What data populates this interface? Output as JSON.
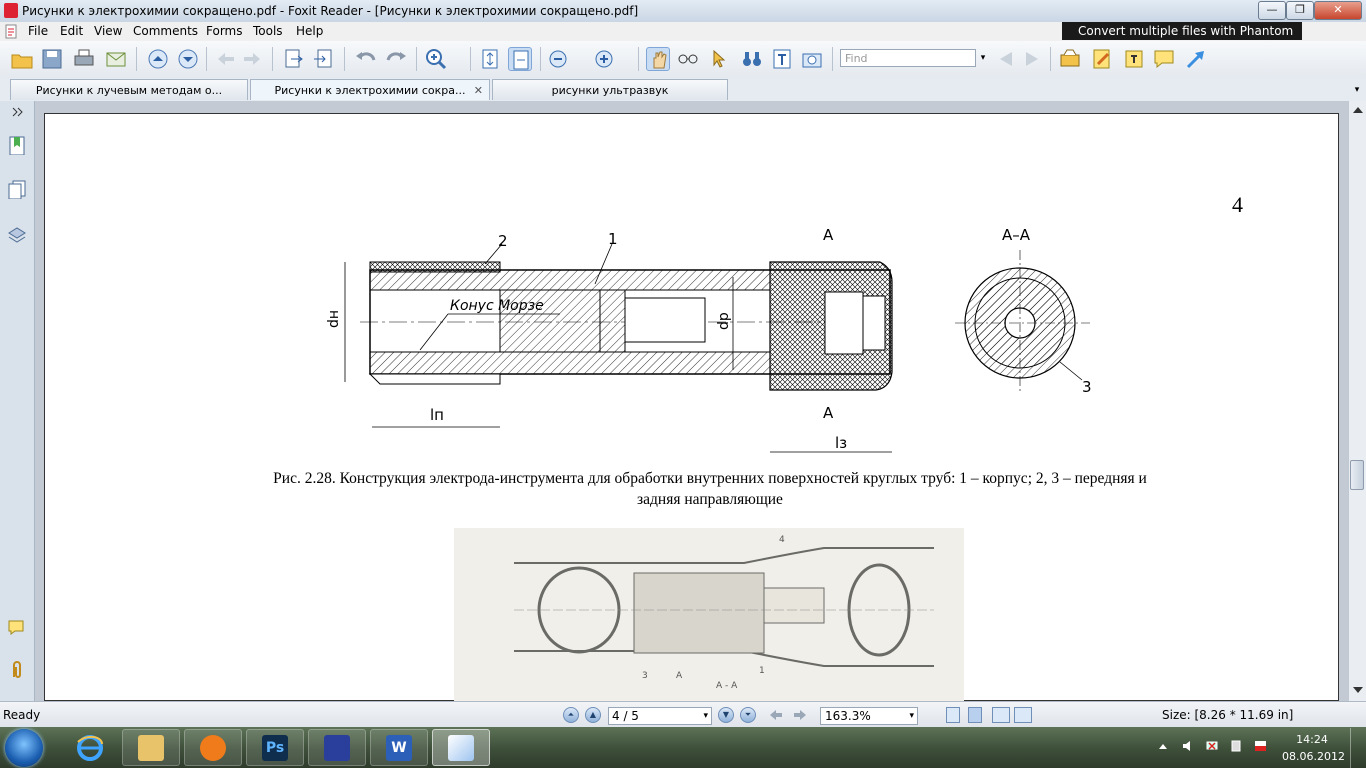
{
  "window": {
    "title": "Рисунки к электрохимии сокращено.pdf - Foxit Reader - [Рисунки к электрохимии сокращено.pdf]",
    "minimize": "—",
    "maximize": "❐",
    "close": "✕"
  },
  "menu": [
    "File",
    "Edit",
    "View",
    "Comments",
    "Forms",
    "Tools",
    "Help"
  ],
  "promo": "Convert multiple files with Phantom",
  "toolbar": {
    "find_placeholder": "Find",
    "find_drop": "▾"
  },
  "tabs": [
    {
      "label": "Рисунки к лучевым методам о...",
      "active": false
    },
    {
      "label": "Рисунки к электрохимии сокра...",
      "active": true,
      "close": "✕"
    },
    {
      "label": "рисунки ультразвук",
      "active": false
    }
  ],
  "tab_scroll": "▾",
  "page": {
    "number": "4",
    "figure_labels": {
      "callout_2": "2",
      "callout_1": "1",
      "callout_3": "3",
      "section_mark_top": "A",
      "section_mark_bottom": "A",
      "section_title": "A–A",
      "morse_taper": "Конус Морзе",
      "dim_dh": "dн",
      "dim_dp": "dр",
      "dim_ln": "lп",
      "dim_l3": "lз"
    },
    "caption_line1": "Рис. 2.28. Конструкция электрода-инструмента для обработки внутренних поверхностей круглых труб: 1 – корпус; 2, 3 – передняя и",
    "caption_line2": "задняя направляющие",
    "photo_labels": {
      "label_4": "4",
      "label_3": "3",
      "label_1": "1",
      "label_a": "A",
      "label_aa": "A - A"
    }
  },
  "status": {
    "text": "Ready",
    "page_indicator": "4 / 5",
    "page_drop": "▾",
    "zoom": "163.3%",
    "zoom_drop": "▾",
    "size": "Size: [8.26 * 11.69 in]"
  },
  "taskbar": {
    "clock_time": "14:24",
    "clock_date": "08.06.2012",
    "apps": [
      "internet-explorer",
      "file-explorer",
      "media-player",
      "photoshop",
      "save-app",
      "word",
      "foxit-reader"
    ],
    "photoshop_label": "Ps",
    "word_label": "W"
  },
  "colors": {
    "accent": "#3a6fb0",
    "titlebar": "#dce6f0",
    "taskbar": "#3d4e39"
  }
}
